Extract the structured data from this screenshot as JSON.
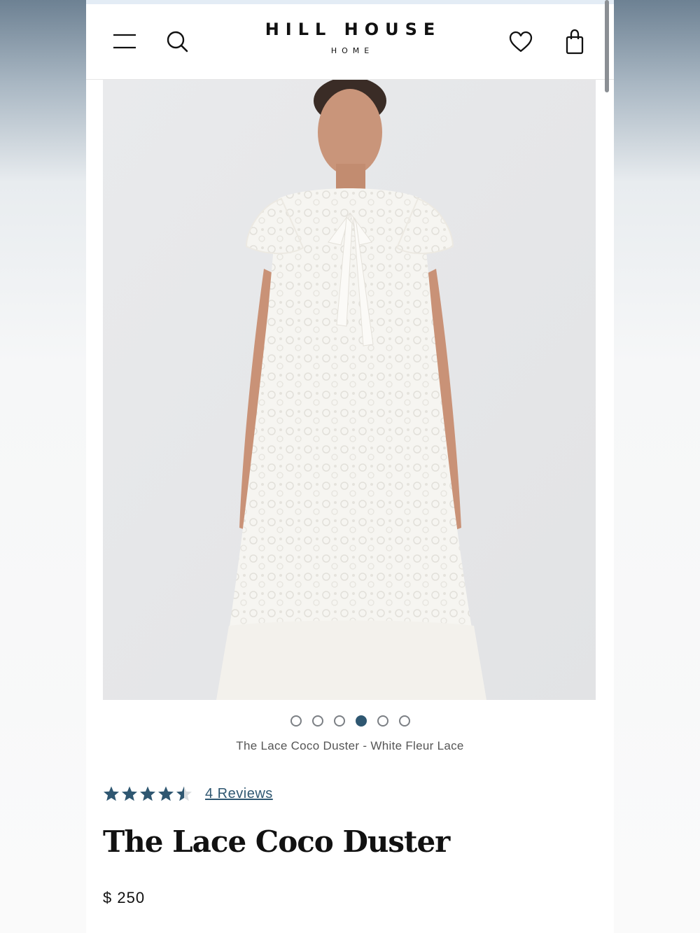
{
  "header": {
    "brand_main": "HILL HOUSE",
    "brand_sub": "HOME"
  },
  "carousel": {
    "slide_count": 6,
    "active_index": 3
  },
  "product": {
    "image_caption": "The Lace Coco Duster - White Fleur Lace",
    "rating_value": 4.5,
    "rating_max": 5,
    "reviews_label": "4 Reviews",
    "title": "The Lace Coco Duster",
    "price": "$ 250"
  },
  "colors": {
    "accent": "#2f5771",
    "star_fill": "#2f5771",
    "text": "#111111"
  },
  "icons": [
    "menu-icon",
    "search-icon",
    "heart-icon",
    "bag-icon"
  ]
}
